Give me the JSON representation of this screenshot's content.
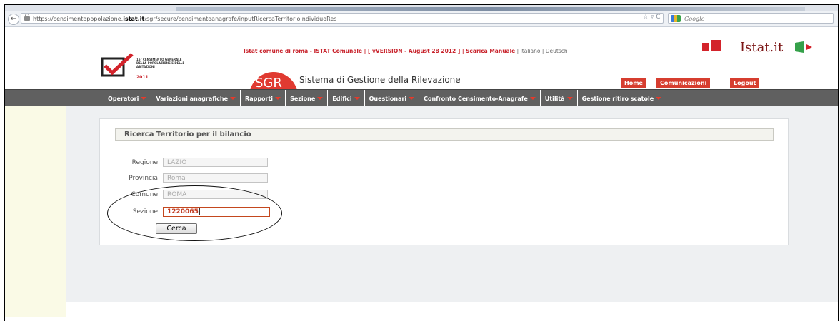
{
  "browser": {
    "url_prefix": "https://censimentopopolazione.",
    "url_host": "istat.it",
    "url_path": "/sgr/secure/censimentoanagrafe/inputRicercaTerritorioIndividuoRes",
    "url_controls": "☆ ▿ C",
    "search_placeholder": "Google"
  },
  "header": {
    "logo_small_text": "15° CENSIMENTO GENERALE DELLA POPOLAZIONE E DELLE ABITAZIONI",
    "logo_year": "2011",
    "info_prefix": "Istat comune di roma - ISTAT Comunale | [ vVERSION - August 28 2012 ] |",
    "scarica_link": "Scarica Manuale",
    "lang_italiano": "Italiano",
    "lang_deutsch": "Deutsch",
    "istat_logo_text": "Istat.it",
    "sgr_label": "SGR",
    "app_title": "Sistema di Gestione della Rilevazione",
    "btn_home": "Home",
    "btn_comunicazioni": "Comunicazioni",
    "btn_logout": "Logout"
  },
  "nav": {
    "items": [
      {
        "label": "Operatori",
        "dropdown": true
      },
      {
        "label": "Variazioni anagrafiche",
        "dropdown": true
      },
      {
        "label": "Rapporti",
        "dropdown": true
      },
      {
        "label": "Sezione",
        "dropdown": true
      },
      {
        "label": "Edifici",
        "dropdown": true
      },
      {
        "label": "Questionari",
        "dropdown": true
      },
      {
        "label": "Confronto Censimento-Anagrafe",
        "dropdown": true
      },
      {
        "label": "Utilità",
        "dropdown": true
      },
      {
        "label": "Gestione ritiro scatole",
        "dropdown": true
      }
    ]
  },
  "form": {
    "title": "Ricerca Territorio per il bilancio",
    "regione_label": "Regione",
    "regione_value": "LAZIO",
    "provincia_label": "Provincia",
    "provincia_value": "Roma",
    "comune_label": "Comune",
    "comune_value": "ROMA",
    "sezione_label": "Sezione",
    "sezione_value": "1220065",
    "submit_label": "Cerca"
  },
  "colors": {
    "accent_red": "#d63d2f",
    "nav_bg": "#606060",
    "panel_title_bg": "#f3f3ee"
  }
}
